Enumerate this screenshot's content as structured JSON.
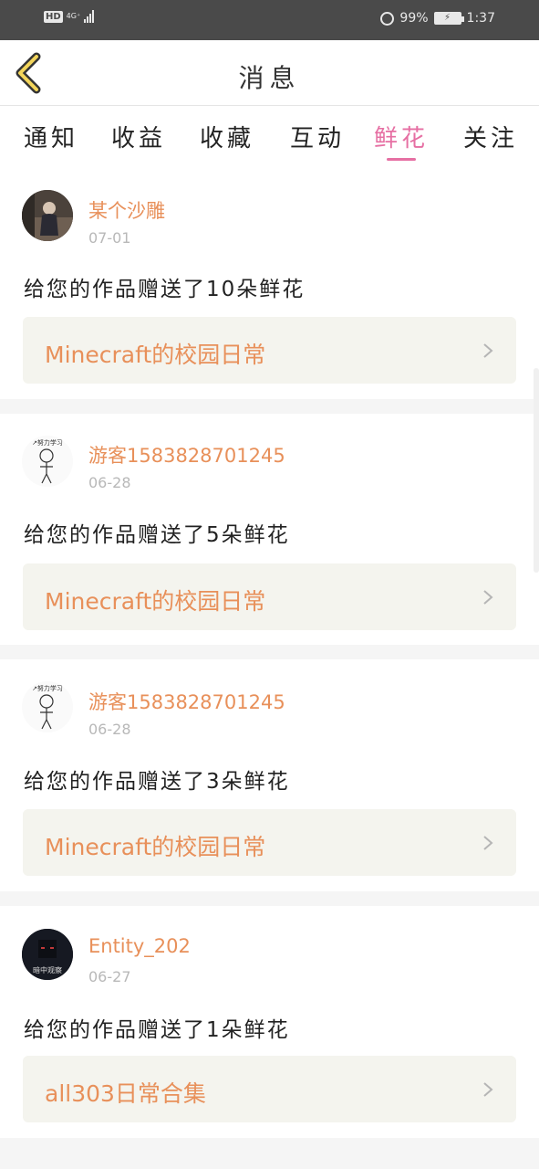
{
  "status_bar": {
    "hd": "HD",
    "network": "4G⁺",
    "battery_percent": "99%",
    "time": "1:37"
  },
  "nav": {
    "title": "消息"
  },
  "tabs": [
    {
      "label": "通知",
      "active": false
    },
    {
      "label": "收益",
      "active": false
    },
    {
      "label": "收藏",
      "active": false
    },
    {
      "label": "互动",
      "active": false
    },
    {
      "label": "鲜花",
      "active": true
    },
    {
      "label": "关注",
      "active": false
    }
  ],
  "messages": [
    {
      "user": "某个沙雕",
      "date": "07-01",
      "text": "给您的作品赠送了10朵鲜花",
      "work": "Minecraft的校园日常",
      "avatar": "photo-avatar"
    },
    {
      "user": "游客1583828701245",
      "date": "06-28",
      "text": "给您的作品赠送了5朵鲜花",
      "work": "Minecraft的校园日常",
      "avatar": "sketch-avatar"
    },
    {
      "user": "游客1583828701245",
      "date": "06-28",
      "text": "给您的作品赠送了3朵鲜花",
      "work": "Minecraft的校园日常",
      "avatar": "sketch-avatar"
    },
    {
      "user": "Entity_202",
      "date": "06-27",
      "text": "给您的作品赠送了1朵鲜花",
      "work": "all303日常合集",
      "avatar": "dark-avatar",
      "avatar_caption": "暗中观察"
    }
  ],
  "colors": {
    "accent_pink": "#e66fa3",
    "name_orange": "#e8905a",
    "status_bar": "#4a4a4a",
    "work_box": "#f4f4ee"
  }
}
